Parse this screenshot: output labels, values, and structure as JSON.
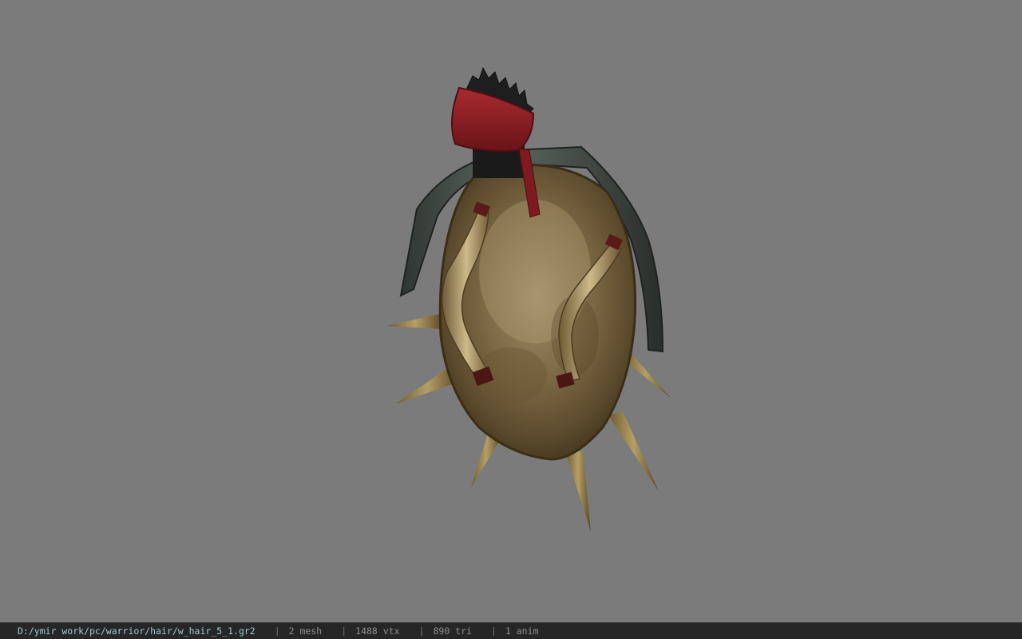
{
  "viewer": {
    "background": "#7b7b7b",
    "model_icon": "spiked-shield-hair-model"
  },
  "statusbar": {
    "file_path": "D:/ymir work/pc/warrior/hair/w_hair_5_1.gr2",
    "separator": "|",
    "mesh": "2 mesh",
    "vertices": "1488 vtx",
    "triangles": "890 tri",
    "animations": "1 anim"
  },
  "colors": {
    "statusbar_bg": "#262626",
    "path_text": "#9fc9d6",
    "stat_text": "#8f8f8f",
    "bandana": "#8e1f25"
  }
}
